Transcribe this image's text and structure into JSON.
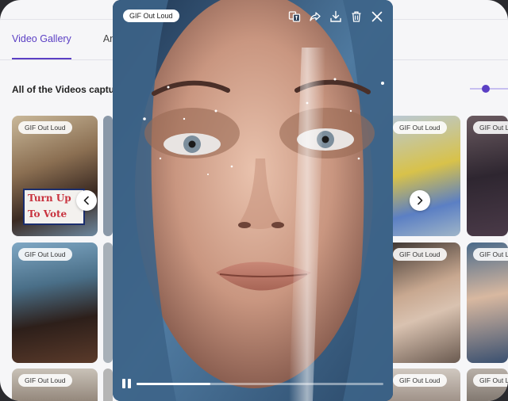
{
  "tabs": [
    {
      "label": "Video Gallery",
      "active": true
    },
    {
      "label": "An",
      "active": false
    }
  ],
  "gallery": {
    "caption": "All of the Videos captu",
    "badge": "GIF Out Loud",
    "sign_lines": [
      "Turn Up",
      "To Vote"
    ]
  },
  "modal": {
    "badge": "GIF Out Loud",
    "progress": 0.3,
    "tools": [
      "translate-icon",
      "share-icon",
      "download-icon",
      "trash-icon",
      "close-icon"
    ]
  },
  "colors": {
    "accent": "#5b3fc4",
    "page_bg": "#f6f6f8"
  }
}
